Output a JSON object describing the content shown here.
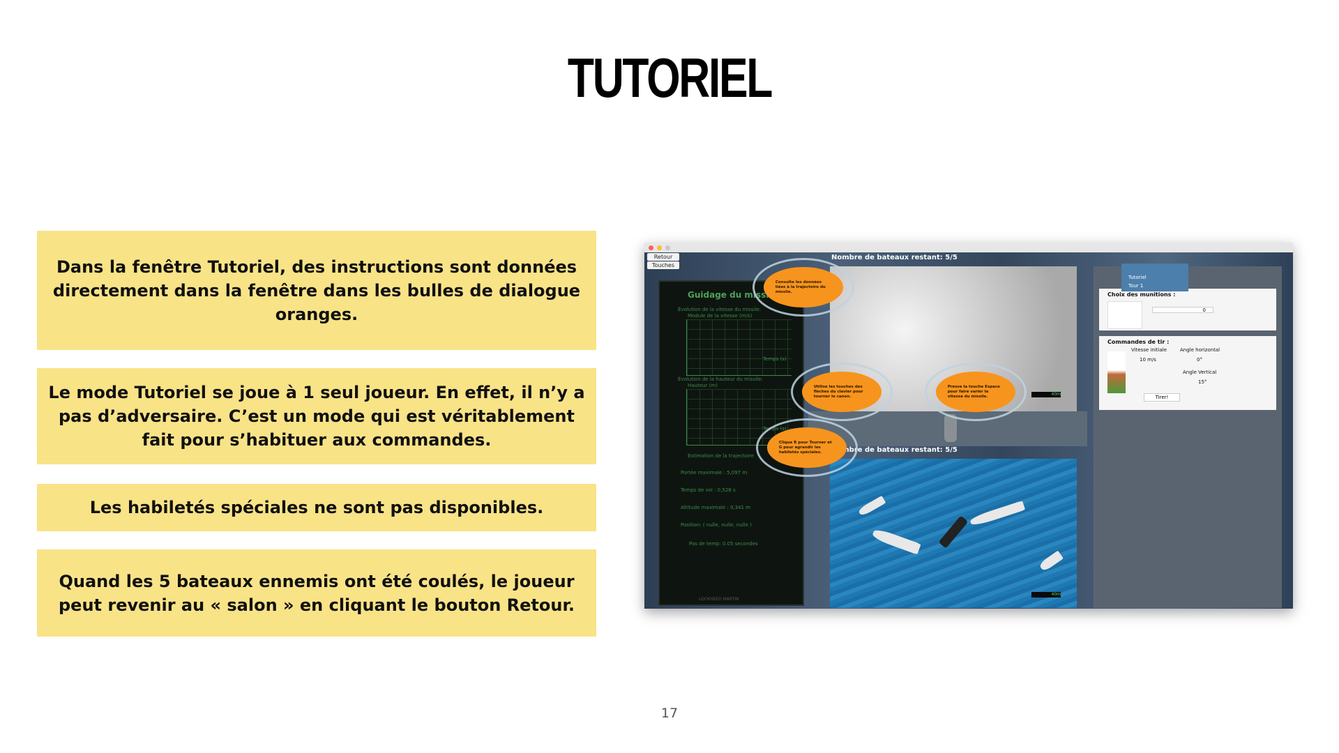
{
  "slide": {
    "title": "TUTORIEL",
    "page_number": "17",
    "boxes": [
      "Dans la fenêtre Tutoriel, des instructions sont données directement dans la fenêtre dans les bulles de dialogue oranges.",
      "Le mode Tutoriel se joue à 1 seul joueur. En effet, il n’y a pas d’adversaire. C’est un mode qui est véritablement fait pour s’habituer aux commandes.",
      "Les habiletés spéciales ne sont pas disponibles.",
      "Quand les 5 bateaux ennemis ont été coulés, le joueur peut revenir au « salon » en cliquant le bouton Retour."
    ],
    "box_color": "#f9e387"
  },
  "screenshot": {
    "buttons": {
      "back": "Retour",
      "keys": "Touches"
    },
    "left_panel": {
      "title": "Guidage du missile",
      "speed_graph_title": "Évolution de la vitesse du missile:",
      "speed_axis": "Module de la vitesse (m/s)",
      "height_graph_title": "Évolution de la hauteur du missile:",
      "height_axis": "Hauteur (m)",
      "time_axis": "Temps (s)",
      "estimation_title": "Estimation de la trajectoire",
      "max_range": "Portée maximale : 5,097 m",
      "flight_time": "Temps de vol : 0,528 s",
      "max_altitude": "Altitude maximale : 0,341 m",
      "position": "Position: ( nulle, nulle, nulle )",
      "time_step": "Pas de temp: 0.05 secondes",
      "brand": "LOCKHEED MARTIN"
    },
    "top_header": "Nombre de bateaux restant: 5/5",
    "bottom_header": "Nombre de bateaux restant: 5/5",
    "range_label": "40m",
    "tab": {
      "line1": "Tutoriel",
      "line2": "Tour 1"
    },
    "ammo": {
      "label": "Choix des munitions :",
      "value": "0"
    },
    "fire": {
      "label": "Commandes de tir :",
      "initial_speed_label": "Vitesse initiale",
      "initial_speed_value": "10 m/s",
      "h_angle_label": "Angle horizontal",
      "h_angle_value": "0°",
      "v_angle_label": "Angle Vertical",
      "v_angle_value": "15°",
      "fire_button": "Tirer!"
    },
    "bubbles": [
      "Consulte les données liées à la trajectoire du missile.",
      "Utilise les touches des flèches du clavier pour tourner le canon.",
      "Presse la touche Espace pour faire varier la vitesse du missile.",
      "Clique R pour Tourner et G pour agrandir les habiletés spéciales."
    ],
    "colors": {
      "bubble": "#f7941d",
      "tab": "#4c7fab"
    }
  }
}
